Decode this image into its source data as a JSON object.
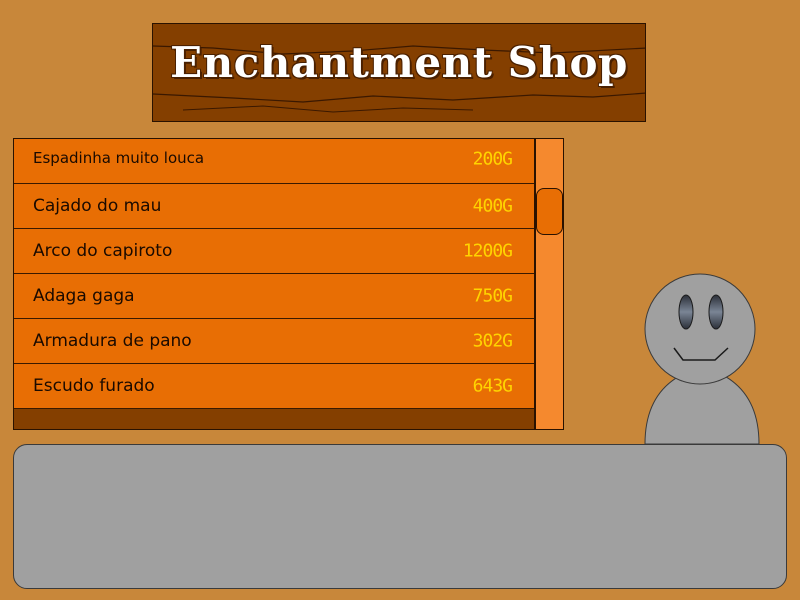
{
  "shop": {
    "title": "Enchantment Shop"
  },
  "items": [
    {
      "name": "Espadinha muito louca",
      "price": "200G"
    },
    {
      "name": "Cajado do mau",
      "price": "400G"
    },
    {
      "name": "Arco do capiroto",
      "price": "1200G"
    },
    {
      "name": "Adaga gaga",
      "price": "750G"
    },
    {
      "name": "Armadura de pano",
      "price": "302G"
    },
    {
      "name": "Escudo furado",
      "price": "643G"
    }
  ],
  "dialog": {
    "text": ""
  },
  "colors": {
    "background": "#c8873a",
    "sign_wood": "#843f00",
    "row_fill": "#e86e04",
    "price_text": "#ffd400",
    "scrollbar_track": "#f5892e",
    "shopkeeper": "#a0a0a0",
    "dialog_fill": "#a0a0a0"
  }
}
